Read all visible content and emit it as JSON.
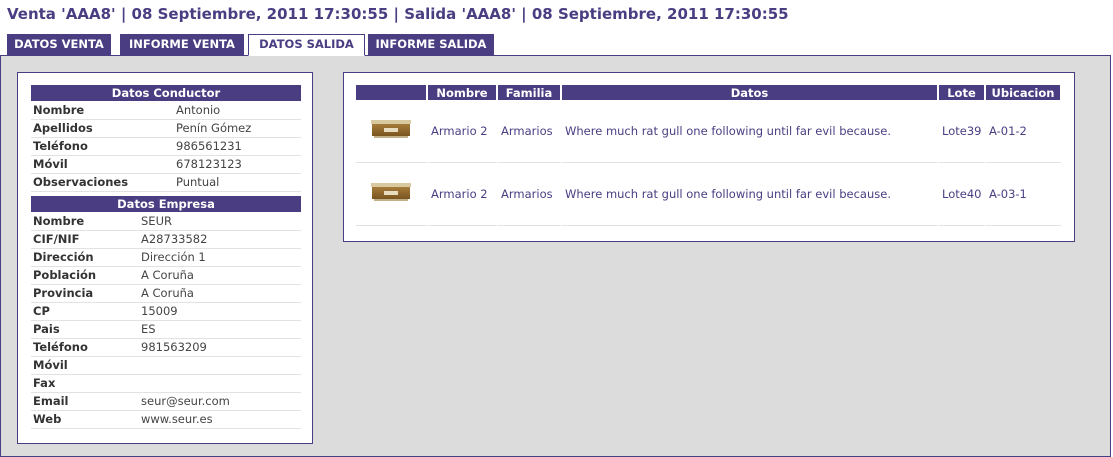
{
  "header": {
    "title": "Venta 'AAA8' | 08 Septiembre, 2011 17:30:55 | Salida 'AAA8' | 08 Septiembre, 2011 17:30:55"
  },
  "tabs": [
    {
      "label": "DATOS VENTA",
      "active": false
    },
    {
      "label": "INFORME VENTA",
      "active": false
    },
    {
      "label": "DATOS SALIDA",
      "active": true
    },
    {
      "label": "INFORME SALIDA",
      "active": false
    }
  ],
  "conductor": {
    "heading": "Datos Conductor",
    "rows": [
      {
        "label": "Nombre",
        "value": "Antonio"
      },
      {
        "label": "Apellidos",
        "value": "Penín Gómez"
      },
      {
        "label": "Teléfono",
        "value": "986561231"
      },
      {
        "label": "Móvil",
        "value": "678123123"
      },
      {
        "label": "Observaciones",
        "value": "Puntual"
      }
    ]
  },
  "empresa": {
    "heading": "Datos Empresa",
    "rows": [
      {
        "label": "Nombre",
        "value": "SEUR"
      },
      {
        "label": "CIF/NIF",
        "value": "A28733582"
      },
      {
        "label": "Dirección",
        "value": "Dirección 1"
      },
      {
        "label": "Población",
        "value": "A Coruña"
      },
      {
        "label": "Provincia",
        "value": "A Coruña"
      },
      {
        "label": "CP",
        "value": "15009"
      },
      {
        "label": "Pais",
        "value": "ES"
      },
      {
        "label": "Teléfono",
        "value": "981563209"
      },
      {
        "label": "Móvil",
        "value": ""
      },
      {
        "label": "Fax",
        "value": ""
      },
      {
        "label": "Email",
        "value": "seur@seur.com"
      },
      {
        "label": "Web",
        "value": "www.seur.es"
      }
    ]
  },
  "items": {
    "columns": [
      "",
      "Nombre",
      "Familia",
      "Datos",
      "Lote",
      "Ubicacion"
    ],
    "rows": [
      {
        "icon": "cabinet-thumbnail",
        "nombre": "Armario 2",
        "familia": "Armarios",
        "datos": "Where much rat gull one following until far evil because.",
        "lote": "Lote39",
        "ubicacion": "A-01-2"
      },
      {
        "icon": "cabinet-thumbnail",
        "nombre": "Armario 2",
        "familia": "Armarios",
        "datos": "Where much rat gull one following until far evil because.",
        "lote": "Lote40",
        "ubicacion": "A-03-1"
      }
    ]
  },
  "colors": {
    "accent": "#4a3d82",
    "panel_bg": "#dcdcdc"
  }
}
